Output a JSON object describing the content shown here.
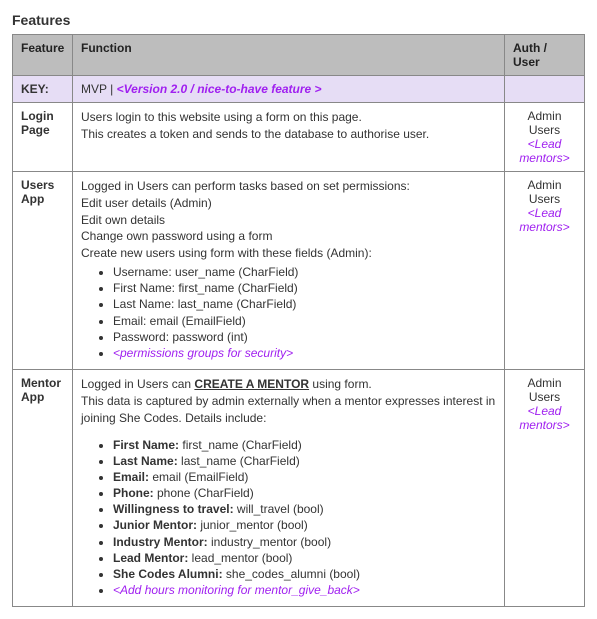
{
  "title": "Features",
  "headers": {
    "feature": "Feature",
    "function": "Function",
    "auth": "Auth / User"
  },
  "key_row": {
    "label": "KEY:",
    "mvp": "MVP",
    "sep": " | ",
    "v2": "<Version 2.0 / nice-to-have feature >"
  },
  "auth": {
    "admin": "Admin",
    "users": "Users",
    "lead": "<Lead mentors>"
  },
  "login": {
    "name": "Login Page",
    "line1": "Users login to this website using a form on this page.",
    "line2": "This creates a token and sends to the database to authorise user."
  },
  "users": {
    "name": "Users App",
    "intro1": "Logged in Users can perform tasks based on set permissions:",
    "intro2": "Edit user details (Admin)",
    "intro3": "Edit own details",
    "intro4": "Change own password using a form",
    "intro5": "Create new users using form with these fields (Admin):",
    "fields": [
      "Username: user_name (CharField)",
      "First Name: first_name (CharField)",
      "Last Name: last_name (CharField)",
      "Email: email (EmailField)",
      "Password: password (int)"
    ],
    "v2field": "<permissions groups for security>"
  },
  "mentor": {
    "name": "Mentor App",
    "intro_pre": "Logged in Users can ",
    "intro_action": "CREATE A MENTOR",
    "intro_post": " using form.",
    "line2": "This data is captured by admin externally when a mentor expresses interest in joining She Codes. Details include:",
    "fields": [
      {
        "label": "First Name:",
        "spec": " first_name (CharField)"
      },
      {
        "label": "Last Name:",
        "spec": " last_name (CharField)"
      },
      {
        "label": "Email:",
        "spec": " email (EmailField)"
      },
      {
        "label": "Phone:",
        "spec": " phone (CharField)"
      },
      {
        "label": "Willingness to travel:",
        "spec": " will_travel (bool)"
      },
      {
        "label": "Junior Mentor:",
        "spec": " junior_mentor (bool)"
      },
      {
        "label": "Industry Mentor:",
        "spec": " industry_mentor (bool)"
      },
      {
        "label": "Lead Mentor:",
        "spec": " lead_mentor (bool)"
      },
      {
        "label": "She Codes Alumni:",
        "spec": " she_codes_alumni (bool)"
      }
    ],
    "v2field": "<Add hours monitoring for mentor_give_back>"
  }
}
